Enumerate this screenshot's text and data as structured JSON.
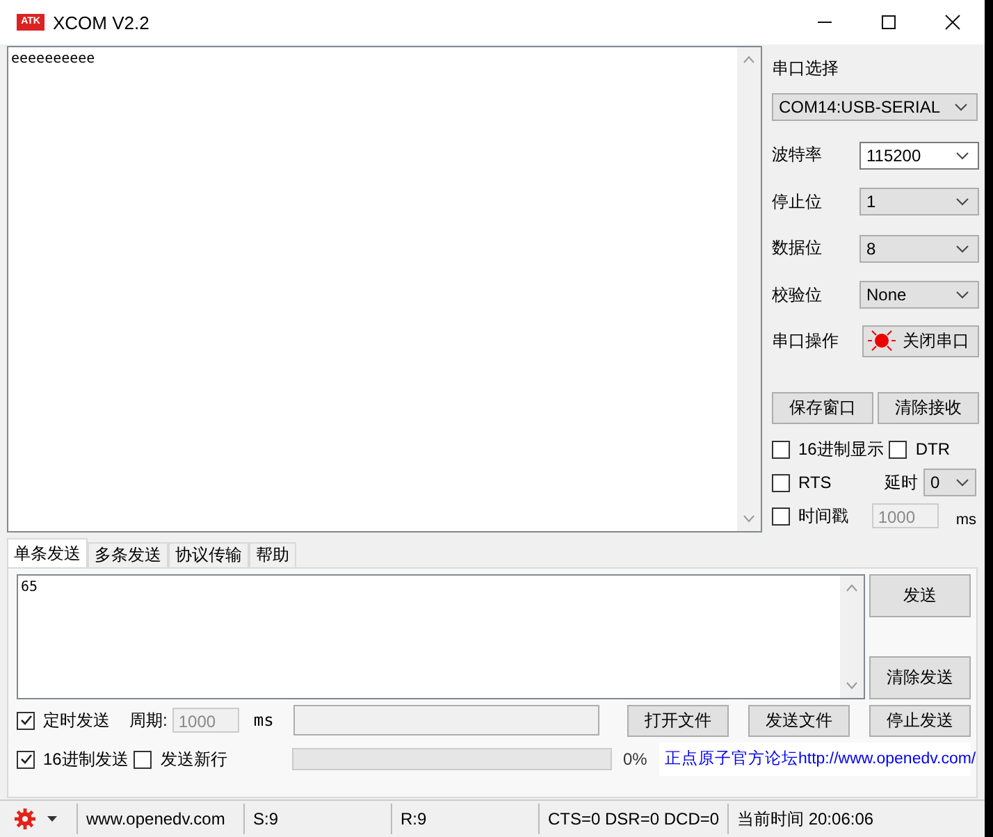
{
  "window": {
    "title": "XCOM V2.2",
    "logo": "ATK"
  },
  "receive": {
    "text": "eeeeeeeeee"
  },
  "serial": {
    "port_label": "串口选择",
    "port_value": "COM14:USB-SERIAL",
    "settings": [
      {
        "label": "波特率",
        "value": "115200",
        "kind": "editable"
      },
      {
        "label": "停止位",
        "value": "1",
        "kind": "list"
      },
      {
        "label": "数据位",
        "value": "8",
        "kind": "list"
      },
      {
        "label": "校验位",
        "value": "None",
        "kind": "list"
      }
    ],
    "operation_label": "串口操作",
    "operation_button": {
      "label": "关闭串口",
      "on": true
    },
    "buttons": [
      "保存窗口",
      "清除接收"
    ],
    "hex_display": {
      "label": "16进制显示",
      "checked": false
    },
    "dtr": {
      "label": "DTR",
      "checked": false
    },
    "rts": {
      "label": "RTS",
      "checked": false
    },
    "delay_label": "延时",
    "delay_value": "0",
    "timestamp": {
      "label": "时间戳",
      "checked": false
    },
    "timestamp_value": "1000",
    "timestamp_unit": "ms"
  },
  "tabs": [
    {
      "label": "单条发送",
      "selected": true
    },
    {
      "label": "多条发送",
      "selected": false
    },
    {
      "label": "协议传输",
      "selected": false
    },
    {
      "label": "帮助",
      "selected": false
    }
  ],
  "send": {
    "text": "65",
    "buttons": [
      "发送",
      "清除发送"
    ]
  },
  "timed": {
    "label": "定时发送",
    "checked": true
  },
  "period_label": "周期:",
  "period_value": "1000",
  "period_unit": "ms",
  "file_buttons": [
    "打开文件",
    "发送文件",
    "停止发送"
  ],
  "hex_send": {
    "label": "16进制发送",
    "checked": true
  },
  "newline": {
    "label": "发送新行",
    "checked": false
  },
  "progress": {
    "level": 0,
    "reading": "0%"
  },
  "forum_link": "正点原子官方论坛http://www.openedv.com/",
  "status_bar": [
    "www.openedv.com",
    "S:9",
    "R:9",
    "CTS=0 DSR=0 DCD=0",
    "当前时间 20:06:06"
  ]
}
